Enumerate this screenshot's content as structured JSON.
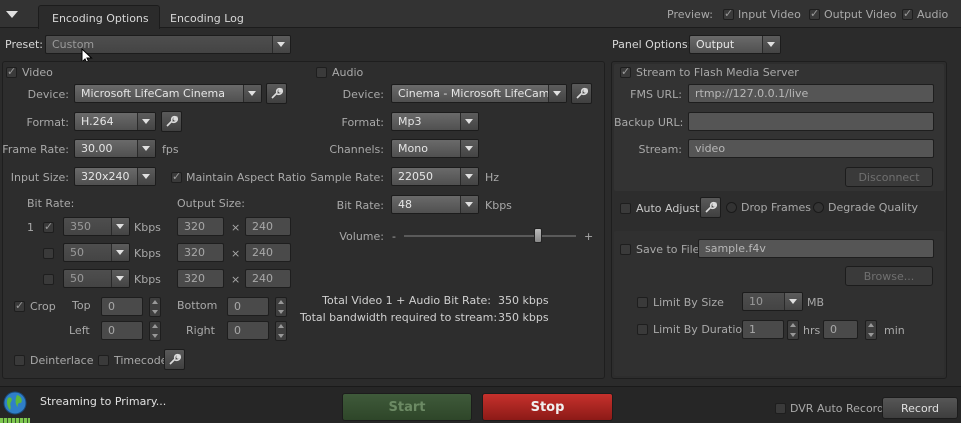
{
  "tabs": [
    {
      "label": "Encoding Options"
    },
    {
      "label": "Encoding Log"
    }
  ],
  "preview": {
    "label": "Preview:",
    "input_video": "Input Video",
    "output_video": "Output Video",
    "audio": "Audio"
  },
  "preset": {
    "label": "Preset:",
    "value": "Custom"
  },
  "panel_options": {
    "label": "Panel Options:",
    "value": "Output"
  },
  "video": {
    "title": "Video",
    "device_label": "Device:",
    "device": "Microsoft LifeCam Cinema",
    "format_label": "Format:",
    "format": "H.264",
    "frame_rate_label": "Frame Rate:",
    "frame_rate": "30.00",
    "fps": "fps",
    "input_size_label": "Input Size:",
    "input_size": "320x240",
    "maintain_aspect": "Maintain Aspect Ratio",
    "bit_rate_label": "Bit Rate:",
    "output_size_label": "Output Size:",
    "rows": [
      {
        "index": "1",
        "bitrate": "350",
        "unit": "Kbps",
        "w": "320",
        "x": "×",
        "h": "240"
      },
      {
        "index": "",
        "bitrate": "50",
        "unit": "Kbps",
        "w": "320",
        "x": "×",
        "h": "240"
      },
      {
        "index": "",
        "bitrate": "50",
        "unit": "Kbps",
        "w": "320",
        "x": "×",
        "h": "240"
      }
    ],
    "crop": "Crop",
    "top_label": "Top",
    "top": "0",
    "left_label": "Left",
    "left": "0",
    "bottom_label": "Bottom",
    "bottom": "0",
    "right_label": "Right",
    "right": "0",
    "deinterlace": "Deinterlace",
    "timecode": "Timecode"
  },
  "audio": {
    "title": "Audio",
    "device_label": "Device:",
    "device": "Cinema - Microsoft LifeCam.",
    "format_label": "Format:",
    "format": "Mp3",
    "channels_label": "Channels:",
    "channels": "Mono",
    "sample_rate_label": "Sample Rate:",
    "sample_rate": "22050",
    "hz": "Hz",
    "bit_rate_label": "Bit Rate:",
    "bit_rate": "48",
    "kbps": "Kbps",
    "volume_label": "Volume:",
    "vol_minus": "-",
    "vol_plus": "+",
    "volume_level": 0.78
  },
  "totals": {
    "total_label": "Total Video 1 + Audio Bit Rate:",
    "total_value": "350 kbps",
    "bandwidth_label": "Total bandwidth required to stream:",
    "bandwidth_value": "350 kbps"
  },
  "fms": {
    "stream_to_fms": "Stream to Flash Media Server",
    "url_label": "FMS URL:",
    "url": "rtmp://127.0.0.1/live",
    "backup_label": "Backup URL:",
    "backup": "",
    "stream_label": "Stream:",
    "stream": "video",
    "disconnect": "Disconnect",
    "auto_adjust": "Auto Adjust",
    "drop_frames": "Drop Frames",
    "degrade_quality": "Degrade Quality"
  },
  "save": {
    "save_to_file": "Save to File",
    "file": "sample.f4v",
    "browse": "Browse...",
    "limit_by_size": "Limit By Size",
    "size": "10",
    "mb": "MB",
    "limit_by_duration": "Limit By Duration",
    "hrs_value": "1",
    "hrs": "hrs",
    "min_value": "0",
    "min": "min"
  },
  "status": {
    "text": "Streaming to Primary...",
    "start": "Start",
    "stop": "Stop",
    "dvr_auto_record": "DVR Auto Record",
    "record": "Record"
  }
}
